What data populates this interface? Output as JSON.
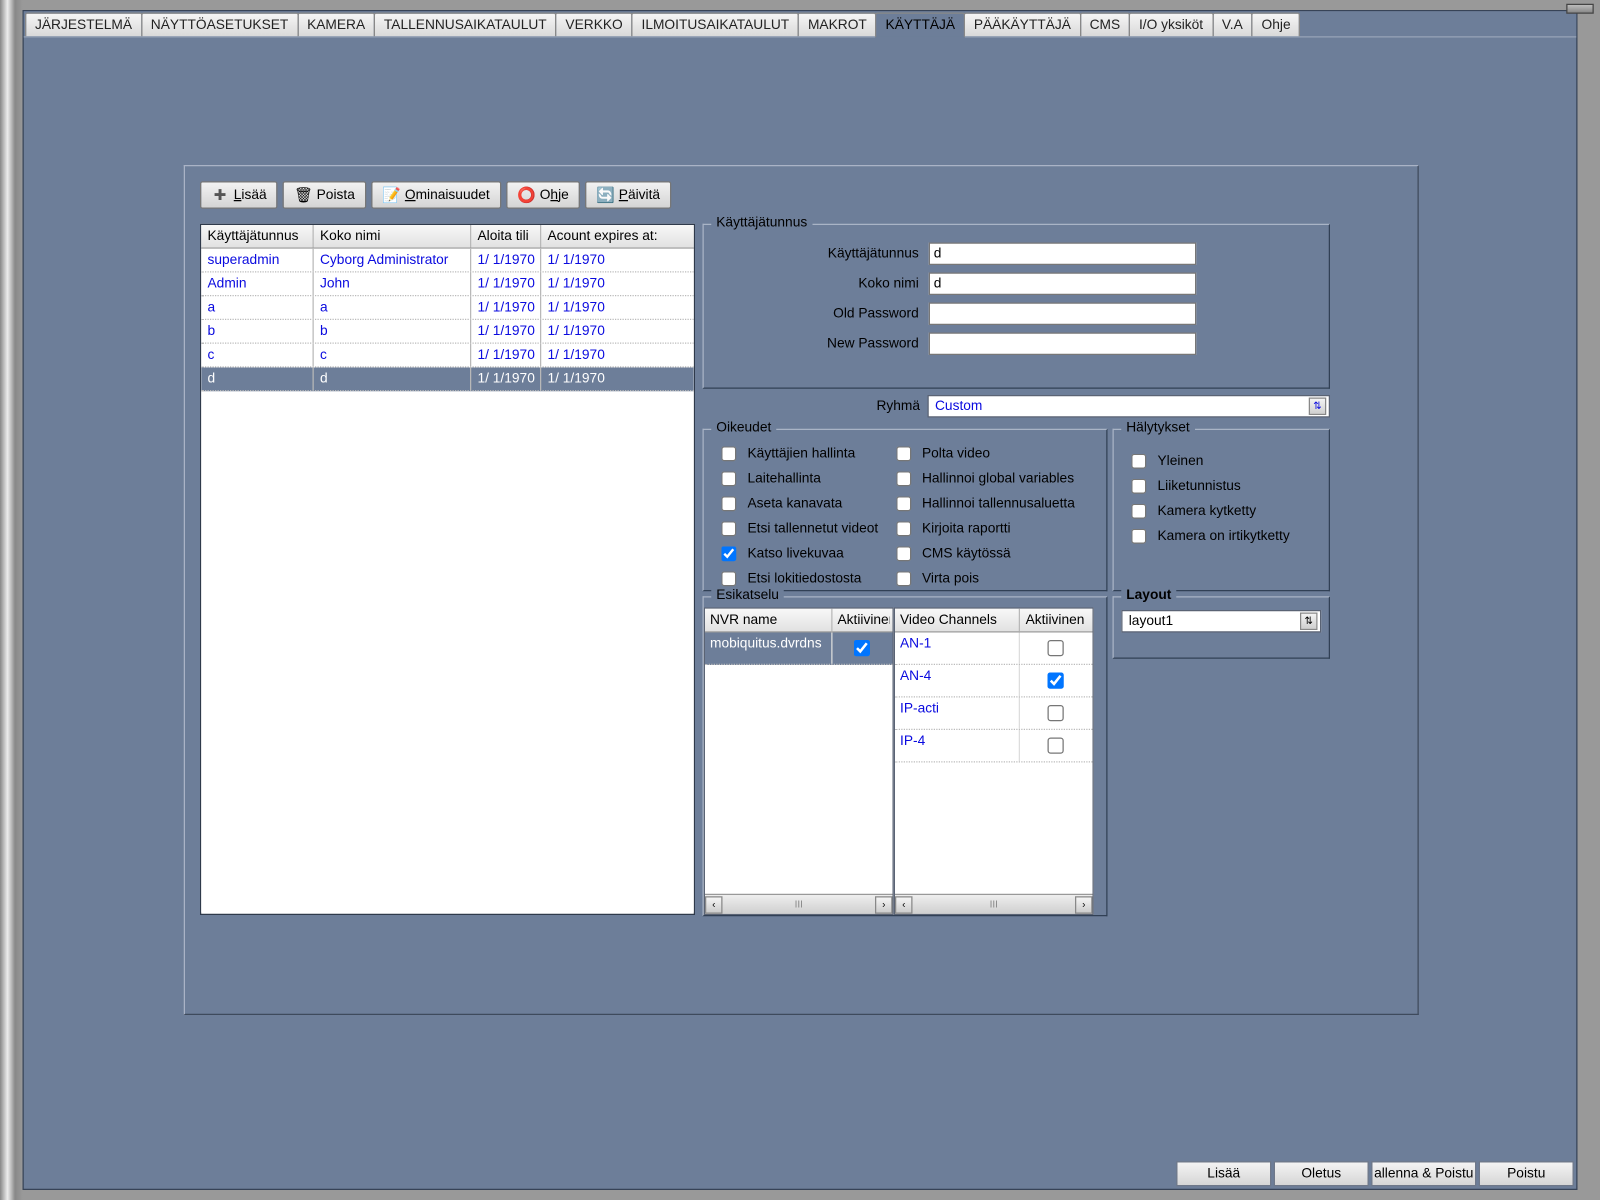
{
  "tabs": [
    "JÄRJESTELMÄ",
    "NÄYTTÖASETUKSET",
    "KAMERA",
    "TALLENNUSAIKATAULUT",
    "VERKKO",
    "ILMOITUSAIKATAULUT",
    "MAKROT",
    "KÄYTTÄJÄ",
    "PÄÄKÄYTTÄJÄ",
    "CMS",
    "I/O yksiköt",
    "V.A",
    "Ohje"
  ],
  "active_tab_index": 7,
  "toolbar": {
    "add": "Lisää",
    "remove": "Poista",
    "properties": "Ominaisuudet",
    "help": "Ohje",
    "refresh": "Päivitä"
  },
  "users_grid": {
    "headers": [
      "Käyttäjätunnus",
      "Koko nimi",
      "Aloita tili",
      "Acount expires at:"
    ],
    "rows": [
      {
        "u": "superadmin",
        "n": "Cyborg Administrator",
        "s": "1/ 1/1970",
        "e": "1/ 1/1970"
      },
      {
        "u": "Admin",
        "n": "John",
        "s": "1/ 1/1970",
        "e": "1/ 1/1970"
      },
      {
        "u": "a",
        "n": "a",
        "s": "1/ 1/1970",
        "e": "1/ 1/1970"
      },
      {
        "u": "b",
        "n": "b",
        "s": "1/ 1/1970",
        "e": "1/ 1/1970"
      },
      {
        "u": "c",
        "n": "c",
        "s": "1/ 1/1970",
        "e": "1/ 1/1970"
      },
      {
        "u": "d",
        "n": "d",
        "s": "1/ 1/1970",
        "e": "1/ 1/1970"
      }
    ],
    "selected_index": 5
  },
  "user_form": {
    "legend": "Käyttäjätunnus",
    "labels": {
      "username": "Käyttäjätunnus",
      "fullname": "Koko nimi",
      "old_pw": "Old Password",
      "new_pw": "New Password"
    },
    "values": {
      "username": "d",
      "fullname": "d",
      "old_pw": "",
      "new_pw": ""
    }
  },
  "group": {
    "label": "Ryhmä",
    "value": "Custom"
  },
  "rights": {
    "legend": "Oikeudet",
    "col1": [
      {
        "label": "Käyttäjien hallinta",
        "checked": false
      },
      {
        "label": "Laitehallinta",
        "checked": false
      },
      {
        "label": "Aseta kanavata",
        "checked": false
      },
      {
        "label": "Etsi tallennetut videot",
        "checked": false
      },
      {
        "label": "Katso livekuvaa",
        "checked": true
      },
      {
        "label": "Etsi lokitiedostosta",
        "checked": false
      }
    ],
    "col2": [
      {
        "label": "Polta video",
        "checked": false
      },
      {
        "label": "Hallinnoi global variables",
        "checked": false
      },
      {
        "label": "Hallinnoi tallennusaluetta",
        "checked": false
      },
      {
        "label": "Kirjoita raportti",
        "checked": false
      },
      {
        "label": "CMS käytössä",
        "checked": false
      },
      {
        "label": "Virta pois",
        "checked": false
      }
    ]
  },
  "alerts": {
    "legend": "Hälytykset",
    "items": [
      {
        "label": "Yleinen",
        "checked": false
      },
      {
        "label": "Liiketunnistus",
        "checked": false
      },
      {
        "label": "Kamera kytketty",
        "checked": false
      },
      {
        "label": "Kamera on irtikytketty",
        "checked": false
      }
    ]
  },
  "preview": {
    "legend": "Esikatselu",
    "nvr_headers": [
      "NVR name",
      "Aktiivinen"
    ],
    "nvr_rows": [
      {
        "name": "mobiquitus.dvrdns",
        "active": true,
        "selected": true
      }
    ],
    "vc_headers": [
      "Video Channels",
      "Aktiivinen"
    ],
    "vc_rows": [
      {
        "name": "AN-1",
        "active": false
      },
      {
        "name": "AN-4",
        "active": true
      },
      {
        "name": "IP-acti",
        "active": false
      },
      {
        "name": "IP-4",
        "active": false
      }
    ]
  },
  "layout": {
    "legend": "Layout",
    "value": "layout1"
  },
  "bottom": {
    "add": "Lisää",
    "default": "Oletus",
    "save": "allenna & Poistu",
    "exit": "Poistu"
  }
}
